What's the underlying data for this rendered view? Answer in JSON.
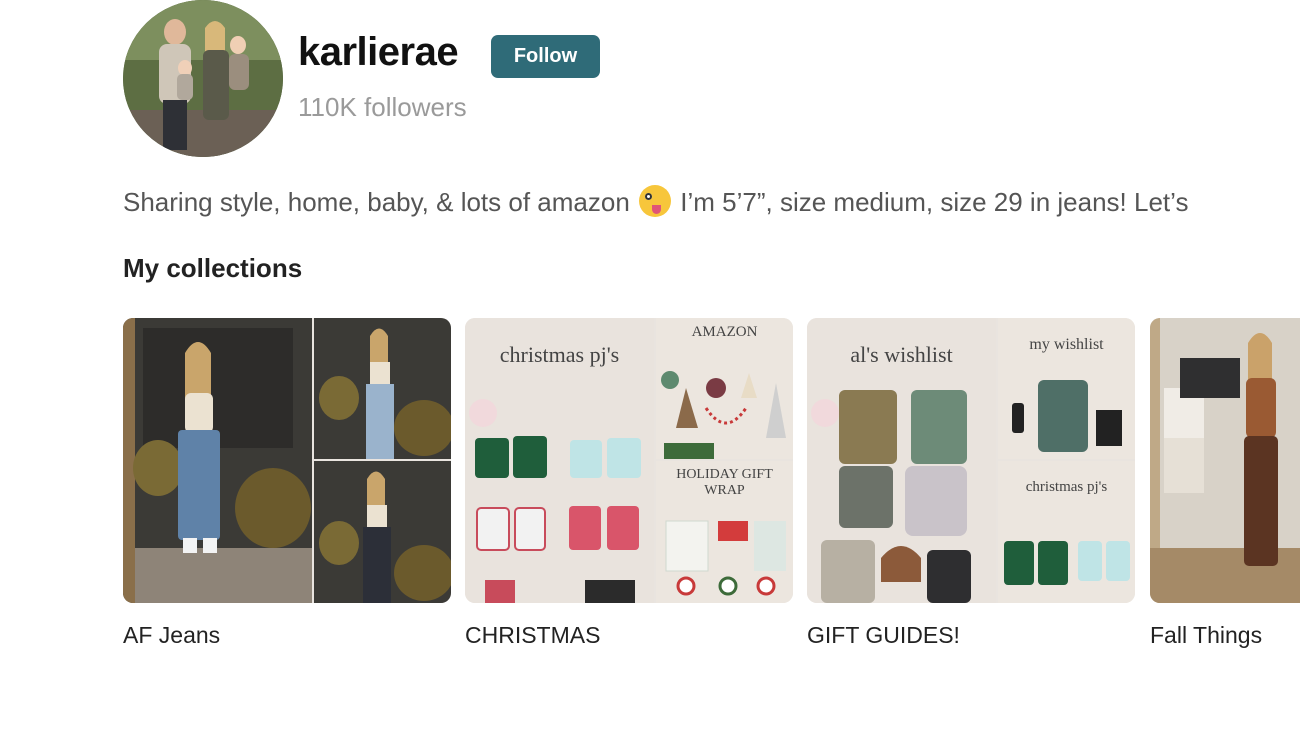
{
  "profile": {
    "username": "karlierae",
    "follow_label": "Follow",
    "followers": "110K followers",
    "bio_before_emoji": "Sharing style, home, baby, & lots of amazon",
    "bio_after_emoji": "I’m 5’7”, size medium, size 29 in jeans! Let’s"
  },
  "collections": {
    "title": "My collections",
    "items": [
      {
        "label": "AF Jeans"
      },
      {
        "label": "CHRISTMAS",
        "captions": [
          "christmas pj's",
          "AMAZON",
          "HOLIDAY GIFT WRAP"
        ]
      },
      {
        "label": "GIFT GUIDES!",
        "captions": [
          "al's wishlist",
          "my wishlist",
          "christmas pj's"
        ]
      },
      {
        "label": "Fall Things"
      }
    ]
  },
  "colors": {
    "follow_button": "#2f6b78",
    "card_background": "#e9e4df"
  }
}
